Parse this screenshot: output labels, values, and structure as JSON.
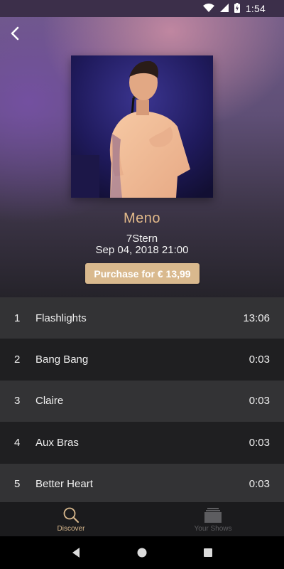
{
  "status_bar": {
    "time": "1:54"
  },
  "concert": {
    "artist": "Meno",
    "venue": "7Stern",
    "datetime": "Sep 04, 2018 21:00",
    "purchase_label": "Purchase for € 13,99"
  },
  "tracks": [
    {
      "num": "1",
      "title": "Flashlights",
      "duration": "13:06"
    },
    {
      "num": "2",
      "title": "Bang Bang",
      "duration": "0:03"
    },
    {
      "num": "3",
      "title": "Claire",
      "duration": "0:03"
    },
    {
      "num": "4",
      "title": "Aux Bras",
      "duration": "0:03"
    },
    {
      "num": "5",
      "title": "Better Heart",
      "duration": "0:03"
    }
  ],
  "bottom_nav": [
    {
      "label": "Discover",
      "icon": "search-icon",
      "active": true
    },
    {
      "label": "Your Shows",
      "icon": "shows-stack-icon",
      "active": false
    }
  ],
  "colors": {
    "accent": "#d9b98e",
    "artist_name": "#e2b98a",
    "row_light": "#333335",
    "row_dark": "#1f1f21"
  }
}
